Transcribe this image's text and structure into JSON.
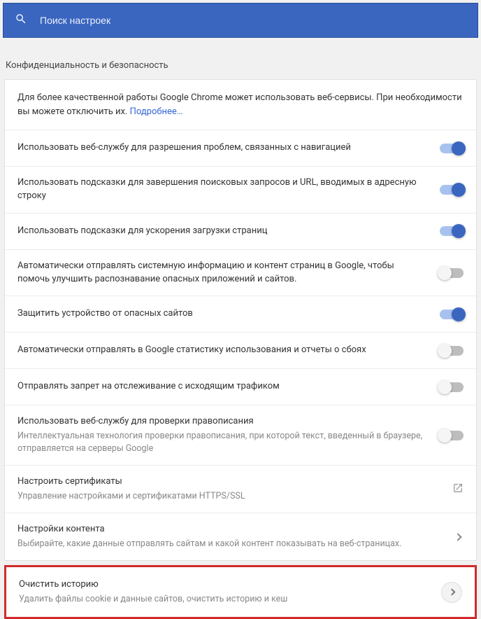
{
  "search": {
    "placeholder": "Поиск настроек"
  },
  "section_title": "Конфиденциальность и безопасность",
  "intro": {
    "text_before": "Для более качественной работы Google Chrome может использовать веб-сервисы. При необходимости вы можете отключить их. ",
    "link": "Подробнее…"
  },
  "rows": {
    "nav_service": {
      "title": "Использовать веб-службу для разрешения проблем, связанных с навигацией"
    },
    "suggestions": {
      "title": "Использовать подсказки для завершения поисковых запросов и URL, вводимых в адресную строку"
    },
    "preload": {
      "title": "Использовать подсказки для ускорения загрузки страниц"
    },
    "sys_info": {
      "title": "Автоматически отправлять системную информацию и контент страниц в Google, чтобы помочь улучшить распознавание опасных приложений и сайтов."
    },
    "safe_browsing": {
      "title": "Защитить устройство от опасных сайтов"
    },
    "crash_stats": {
      "title": "Автоматически отправлять в Google статистику использования и отчеты о сбоях"
    },
    "dnt": {
      "title": "Отправлять запрет на отслеживание с исходящим трафиком"
    },
    "spellcheck": {
      "title": "Использовать веб-службу для проверки правописания",
      "sub": "Интеллектуальная технология проверки правописания, при которой текст, введенный в браузере, отправляется на серверы Google"
    },
    "certs": {
      "title": "Настроить сертификаты",
      "sub": "Управление настройками и сертификатами HTTPS/SSL"
    },
    "content": {
      "title": "Настройки контента",
      "sub": "Выбирайте, какие данные отправлять сайтам и какой контент показывать на веб-страницах."
    },
    "clear": {
      "title": "Очистить историю",
      "sub": "Удалить файлы cookie и данные сайтов, очистить историю и кеш"
    }
  },
  "toggles": {
    "nav_service": true,
    "suggestions": true,
    "preload": true,
    "sys_info": false,
    "safe_browsing": true,
    "crash_stats": false,
    "dnt": false,
    "spellcheck": false
  }
}
